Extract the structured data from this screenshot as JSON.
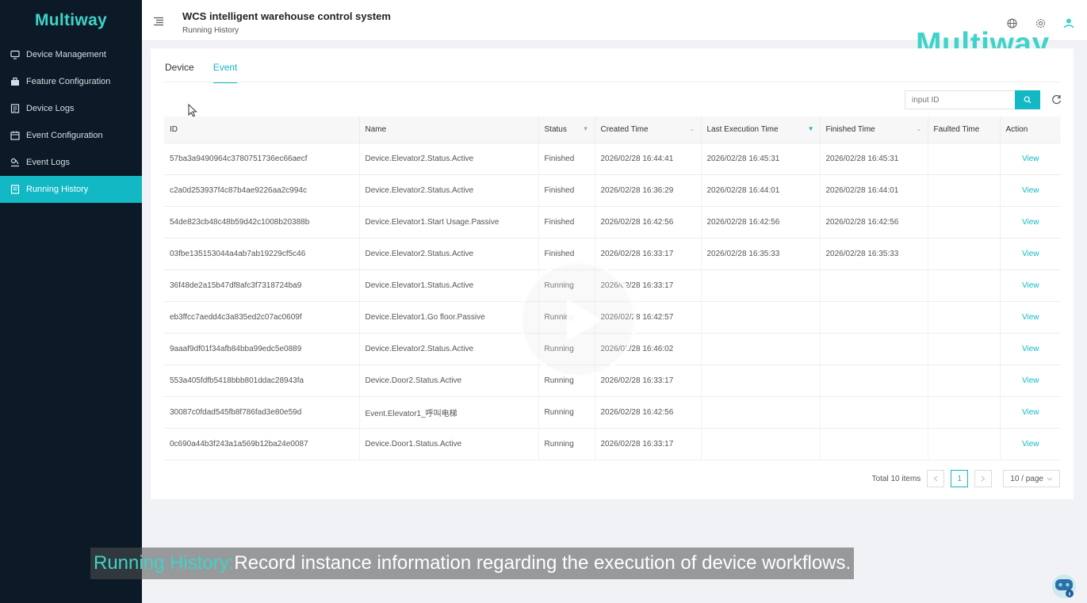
{
  "sidebar": {
    "logo": "Multiway",
    "items": [
      {
        "label": "Device Management",
        "icon": "monitor-icon"
      },
      {
        "label": "Feature Configuration",
        "icon": "toolbox-icon"
      },
      {
        "label": "Device Logs",
        "icon": "log-icon"
      },
      {
        "label": "Event Configuration",
        "icon": "calendar-icon"
      },
      {
        "label": "Event Logs",
        "icon": "event-log-icon"
      },
      {
        "label": "Running History",
        "icon": "history-icon",
        "active": true
      }
    ]
  },
  "header": {
    "title": "WCS intelligent warehouse control system",
    "subtitle": "Running History",
    "icons": [
      "globe-icon",
      "settings-icon",
      "user-icon"
    ]
  },
  "watermark": "Multiway",
  "tabs": [
    {
      "label": "Device"
    },
    {
      "label": "Event",
      "active": true
    }
  ],
  "search": {
    "placeholder": "input ID"
  },
  "table": {
    "columns": [
      "ID",
      "Name",
      "Status",
      "Created Time",
      "Last Execution Time",
      "Finished Time",
      "Faulted Time",
      "Action"
    ],
    "rows": [
      {
        "id": "57ba3a9490964c3780751736ec66aecf",
        "name": "Device.Elevator2.Status.Active",
        "status": "Finished",
        "created": "2026/02/28 16:44:41",
        "last": "2026/02/28 16:45:31",
        "finished": "2026/02/28 16:45:31",
        "faulted": "",
        "action": "View"
      },
      {
        "id": "c2a0d253937f4c87b4ae9226aa2c994c",
        "name": "Device.Elevator2.Status.Active",
        "status": "Finished",
        "created": "2026/02/28 16:36:29",
        "last": "2026/02/28 16:44:01",
        "finished": "2026/02/28 16:44:01",
        "faulted": "",
        "action": "View"
      },
      {
        "id": "54de823cb48c48b59d42c1008b20388b",
        "name": "Device.Elevator1.Start Usage.Passive",
        "status": "Finished",
        "created": "2026/02/28 16:42:56",
        "last": "2026/02/28 16:42:56",
        "finished": "2026/02/28 16:42:56",
        "faulted": "",
        "action": "View"
      },
      {
        "id": "03fbe135153044a4ab7ab19229cf5c46",
        "name": "Device.Elevator2.Status.Active",
        "status": "Finished",
        "created": "2026/02/28 16:33:17",
        "last": "2026/02/28 16:35:33",
        "finished": "2026/02/28 16:35:33",
        "faulted": "",
        "action": "View"
      },
      {
        "id": "36f48de2a15b47df8afc3f7318724ba9",
        "name": "Device.Elevator1.Status.Active",
        "status": "Running",
        "created": "2026/02/28 16:33:17",
        "last": "",
        "finished": "",
        "faulted": "",
        "action": "View"
      },
      {
        "id": "eb3ffcc7aedd4c3a835ed2c07ac0609f",
        "name": "Device.Elevator1.Go floor.Passive",
        "status": "Running",
        "created": "2026/02/28 16:42:57",
        "last": "",
        "finished": "",
        "faulted": "",
        "action": "View"
      },
      {
        "id": "9aaaf9df01f34afb84bba99edc5e0889",
        "name": "Device.Elevator2.Status.Active",
        "status": "Running",
        "created": "2026/02/28 16:46:02",
        "last": "",
        "finished": "",
        "faulted": "",
        "action": "View"
      },
      {
        "id": "553a405fdfb5418bbb801ddac28943fa",
        "name": "Device.Door2.Status.Active",
        "status": "Running",
        "created": "2026/02/28 16:33:17",
        "last": "",
        "finished": "",
        "faulted": "",
        "action": "View"
      },
      {
        "id": "30087c0fdad545fb8f786fad3e80e59d",
        "name": "Event.Elevator1_呼叫电梯",
        "status": "Running",
        "created": "2026/02/28 16:42:56",
        "last": "",
        "finished": "",
        "faulted": "",
        "action": "View"
      },
      {
        "id": "0c690a44b3f243a1a569b12ba24e0087",
        "name": "Device.Door1.Status.Active",
        "status": "Running",
        "created": "2026/02/28 16:33:17",
        "last": "",
        "finished": "",
        "faulted": "",
        "action": "View"
      }
    ]
  },
  "pagination": {
    "total": "Total 10 items",
    "current": "1",
    "page_size": "10 / page"
  },
  "caption": {
    "highlight": "Running History:",
    "text": "Record instance information regarding the execution of device workflows."
  },
  "colors": {
    "accent": "#12b8c4",
    "sidebar_bg": "#0b1a26",
    "brand": "#3fd3c9"
  }
}
